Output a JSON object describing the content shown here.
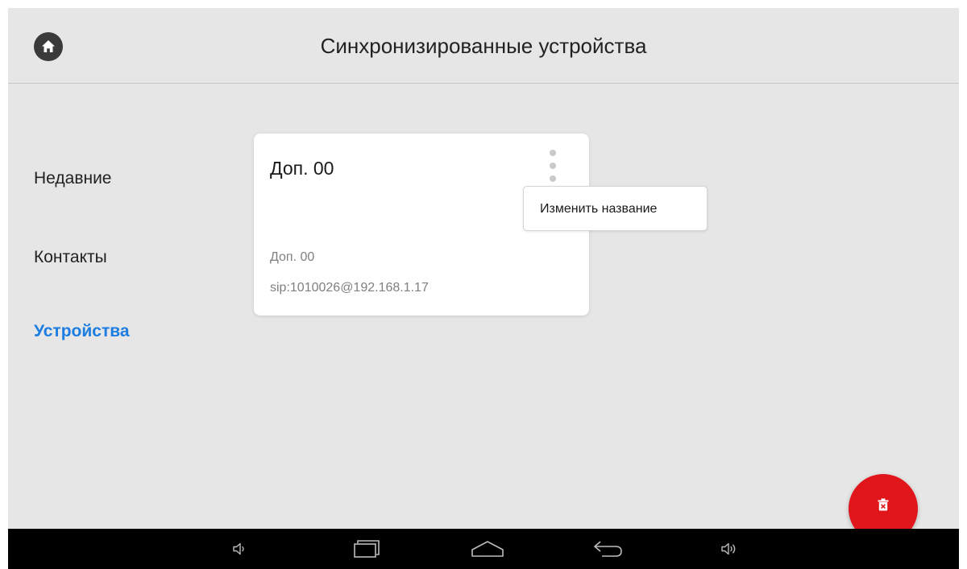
{
  "header": {
    "title": "Синхронизированные устройства",
    "home_icon": "home-icon"
  },
  "sidebar": {
    "items": [
      {
        "label": "Недавние",
        "active": false
      },
      {
        "label": "Контакты",
        "active": false
      },
      {
        "label": "Устройства",
        "active": true
      }
    ]
  },
  "device_card": {
    "title": "Доп. 00",
    "name": "Доп. 00",
    "address": "sip:1010026@192.168.1.17",
    "menu_icon": "more-vertical-icon"
  },
  "context_menu": {
    "items": [
      {
        "label": "Изменить название"
      }
    ]
  },
  "fab": {
    "icon": "delete-icon",
    "color": "#e0161b"
  },
  "system_nav": {
    "icons": [
      "volume-down-icon",
      "recent-apps-icon",
      "home-icon",
      "back-icon",
      "volume-up-icon"
    ]
  },
  "colors": {
    "accent": "#1b7de2",
    "background": "#e6e6e6",
    "card": "#ffffff"
  }
}
